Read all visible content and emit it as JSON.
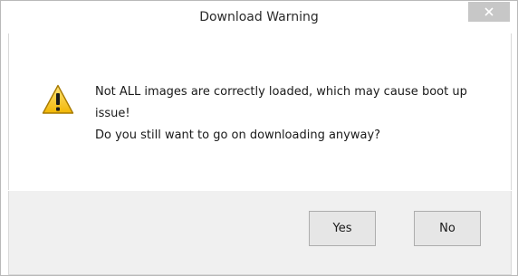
{
  "window": {
    "title": "Download Warning",
    "close_icon": "close-icon"
  },
  "dialog": {
    "icon": "warning-icon",
    "message_line1": "Not ALL images are correctly loaded, which may cause boot up",
    "message_line2": "issue!",
    "message_line3": "Do you still want to go on downloading anyway?"
  },
  "buttons": {
    "yes_label": "Yes",
    "no_label": "No"
  },
  "colors": {
    "close_button_bg": "#c7c7c7",
    "footer_bg": "#f0f0f0",
    "warning_fill": "#f5c518"
  }
}
